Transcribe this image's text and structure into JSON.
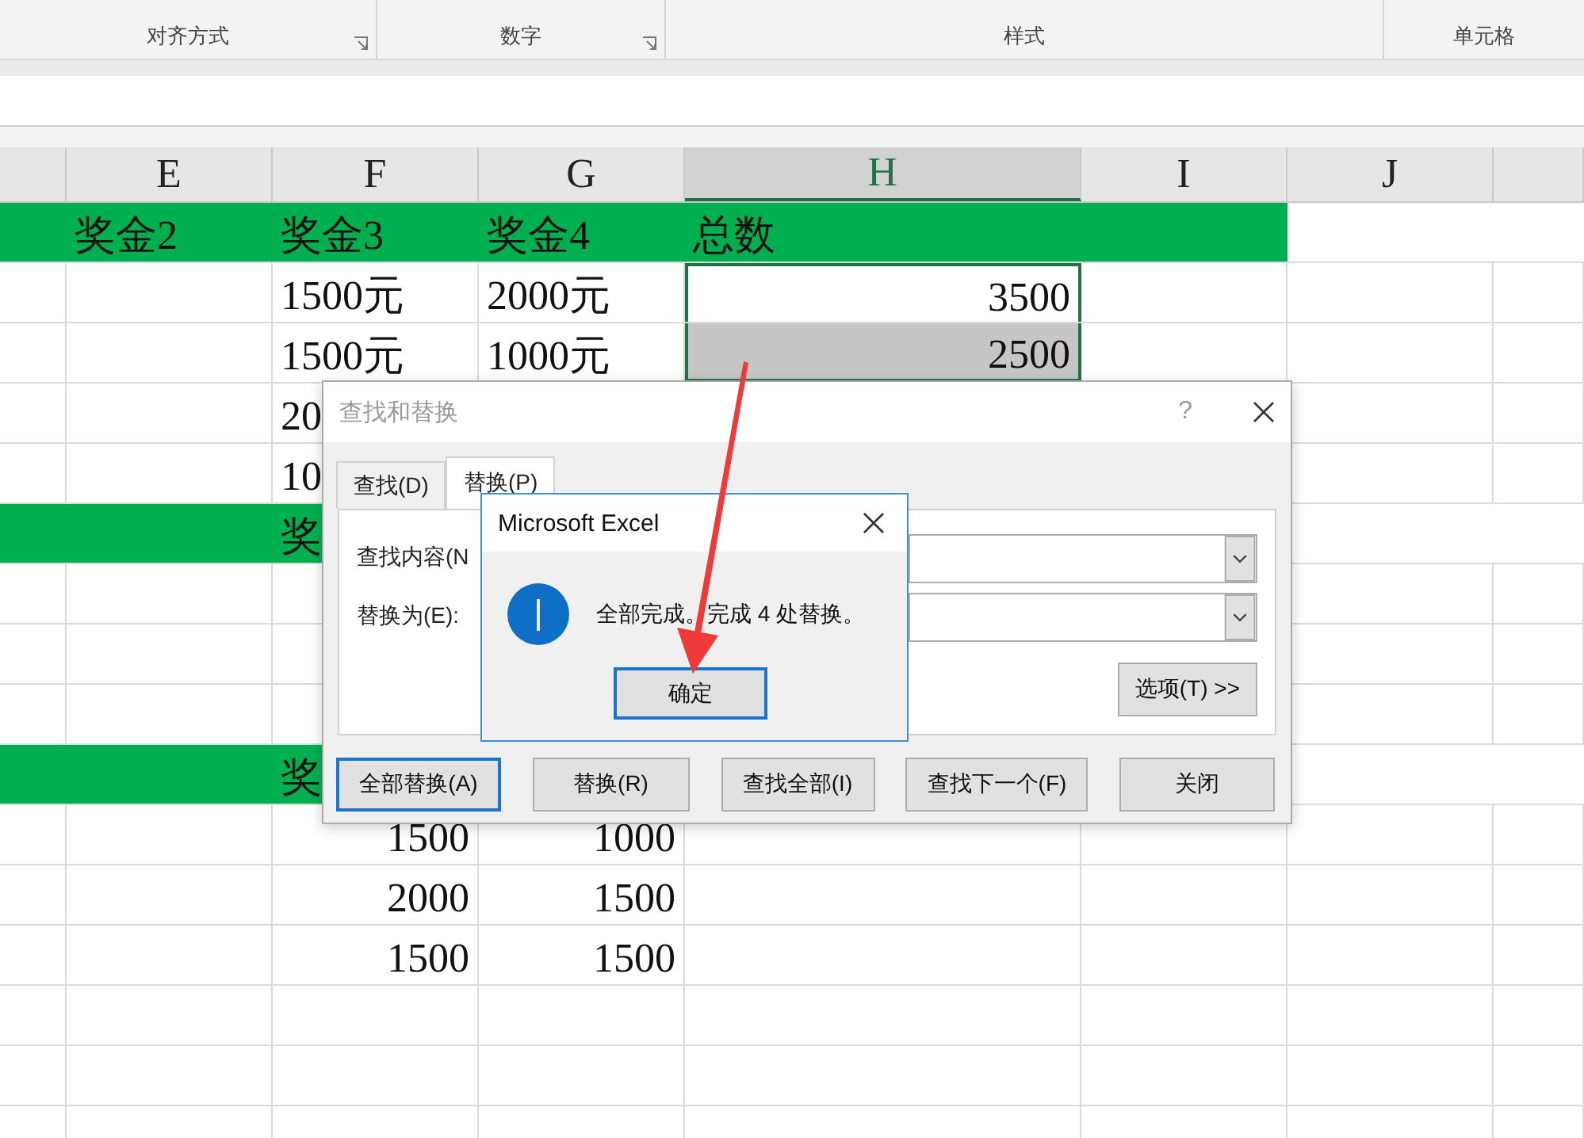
{
  "ribbon": {
    "groups": [
      {
        "label": "对齐方式",
        "launcher": true
      },
      {
        "label": "数字",
        "launcher": true
      },
      {
        "label": "样式",
        "launcher": false
      },
      {
        "label": "单元格",
        "launcher": false
      }
    ]
  },
  "columns": [
    {
      "label": "E",
      "selected": false
    },
    {
      "label": "F",
      "selected": false
    },
    {
      "label": "G",
      "selected": false
    },
    {
      "label": "H",
      "selected": true
    },
    {
      "label": "I",
      "selected": false
    },
    {
      "label": "J",
      "selected": false
    }
  ],
  "rows": [
    {
      "kind": "band",
      "cells": {
        "E": {
          "text": "奖金2",
          "kind": "text",
          "selected": false
        },
        "F": {
          "text": "奖金3",
          "kind": "text",
          "selected": false
        },
        "G": {
          "text": "奖金4",
          "kind": "text",
          "selected": false
        },
        "H": {
          "text": "总数",
          "kind": "text",
          "selected": false
        }
      }
    },
    {
      "kind": "data",
      "cells": {
        "F": {
          "text": "1500元",
          "kind": "text",
          "selected": false
        },
        "G": {
          "text": "2000元",
          "kind": "text",
          "selected": false
        },
        "H": {
          "text": "3500",
          "kind": "number",
          "selected": true
        }
      }
    },
    {
      "kind": "data",
      "cells": {
        "F": {
          "text": "1500元",
          "kind": "text",
          "selected": false
        },
        "G": {
          "text": "1000元",
          "kind": "text",
          "selected": false
        },
        "H": {
          "text": "2500",
          "kind": "number",
          "selected": true
        }
      }
    },
    {
      "kind": "data",
      "cells": {
        "F": {
          "text": "20",
          "kind": "text",
          "selected": false
        }
      }
    },
    {
      "kind": "data",
      "cells": {
        "F": {
          "text": "10",
          "kind": "text",
          "selected": false
        }
      }
    },
    {
      "kind": "band",
      "cells": {
        "F": {
          "text": "奖",
          "kind": "text",
          "selected": false
        }
      }
    },
    {
      "kind": "data"
    },
    {
      "kind": "data"
    },
    {
      "kind": "data"
    },
    {
      "kind": "band",
      "cells": {
        "F": {
          "text": "奖",
          "kind": "text",
          "selected": false
        }
      }
    },
    {
      "kind": "data",
      "cells": {
        "F": {
          "text": "1500",
          "kind": "number",
          "selected": false
        },
        "G": {
          "text": "1000",
          "kind": "number",
          "selected": false
        }
      }
    },
    {
      "kind": "data",
      "cells": {
        "F": {
          "text": "2000",
          "kind": "number",
          "selected": false
        },
        "G": {
          "text": "1500",
          "kind": "number",
          "selected": false
        }
      }
    },
    {
      "kind": "data",
      "cells": {
        "F": {
          "text": "1500",
          "kind": "number",
          "selected": false
        },
        "G": {
          "text": "1500",
          "kind": "number",
          "selected": false
        }
      }
    },
    {
      "kind": "data"
    },
    {
      "kind": "data"
    },
    {
      "kind": "data"
    }
  ],
  "find_replace": {
    "title": "查找和替换",
    "help": "?",
    "tabs": [
      {
        "label": "查找(D)",
        "selected": false
      },
      {
        "label": "替换(P)",
        "selected": true
      }
    ],
    "fields": [
      {
        "label": "查找内容(N"
      },
      {
        "label": "替换为(E):"
      }
    ],
    "options_button": "选项(T) >>",
    "buttons": [
      {
        "label": "全部替换(A)",
        "focused": true
      },
      {
        "label": "替换(R)",
        "focused": false
      },
      {
        "label": "查找全部(I)",
        "focused": false
      },
      {
        "label": "查找下一个(F)",
        "focused": false
      },
      {
        "label": "关闭",
        "focused": false
      }
    ]
  },
  "message_box": {
    "title": "Microsoft Excel",
    "message": "全部完成。完成 4 处替换。",
    "button": "确定"
  }
}
